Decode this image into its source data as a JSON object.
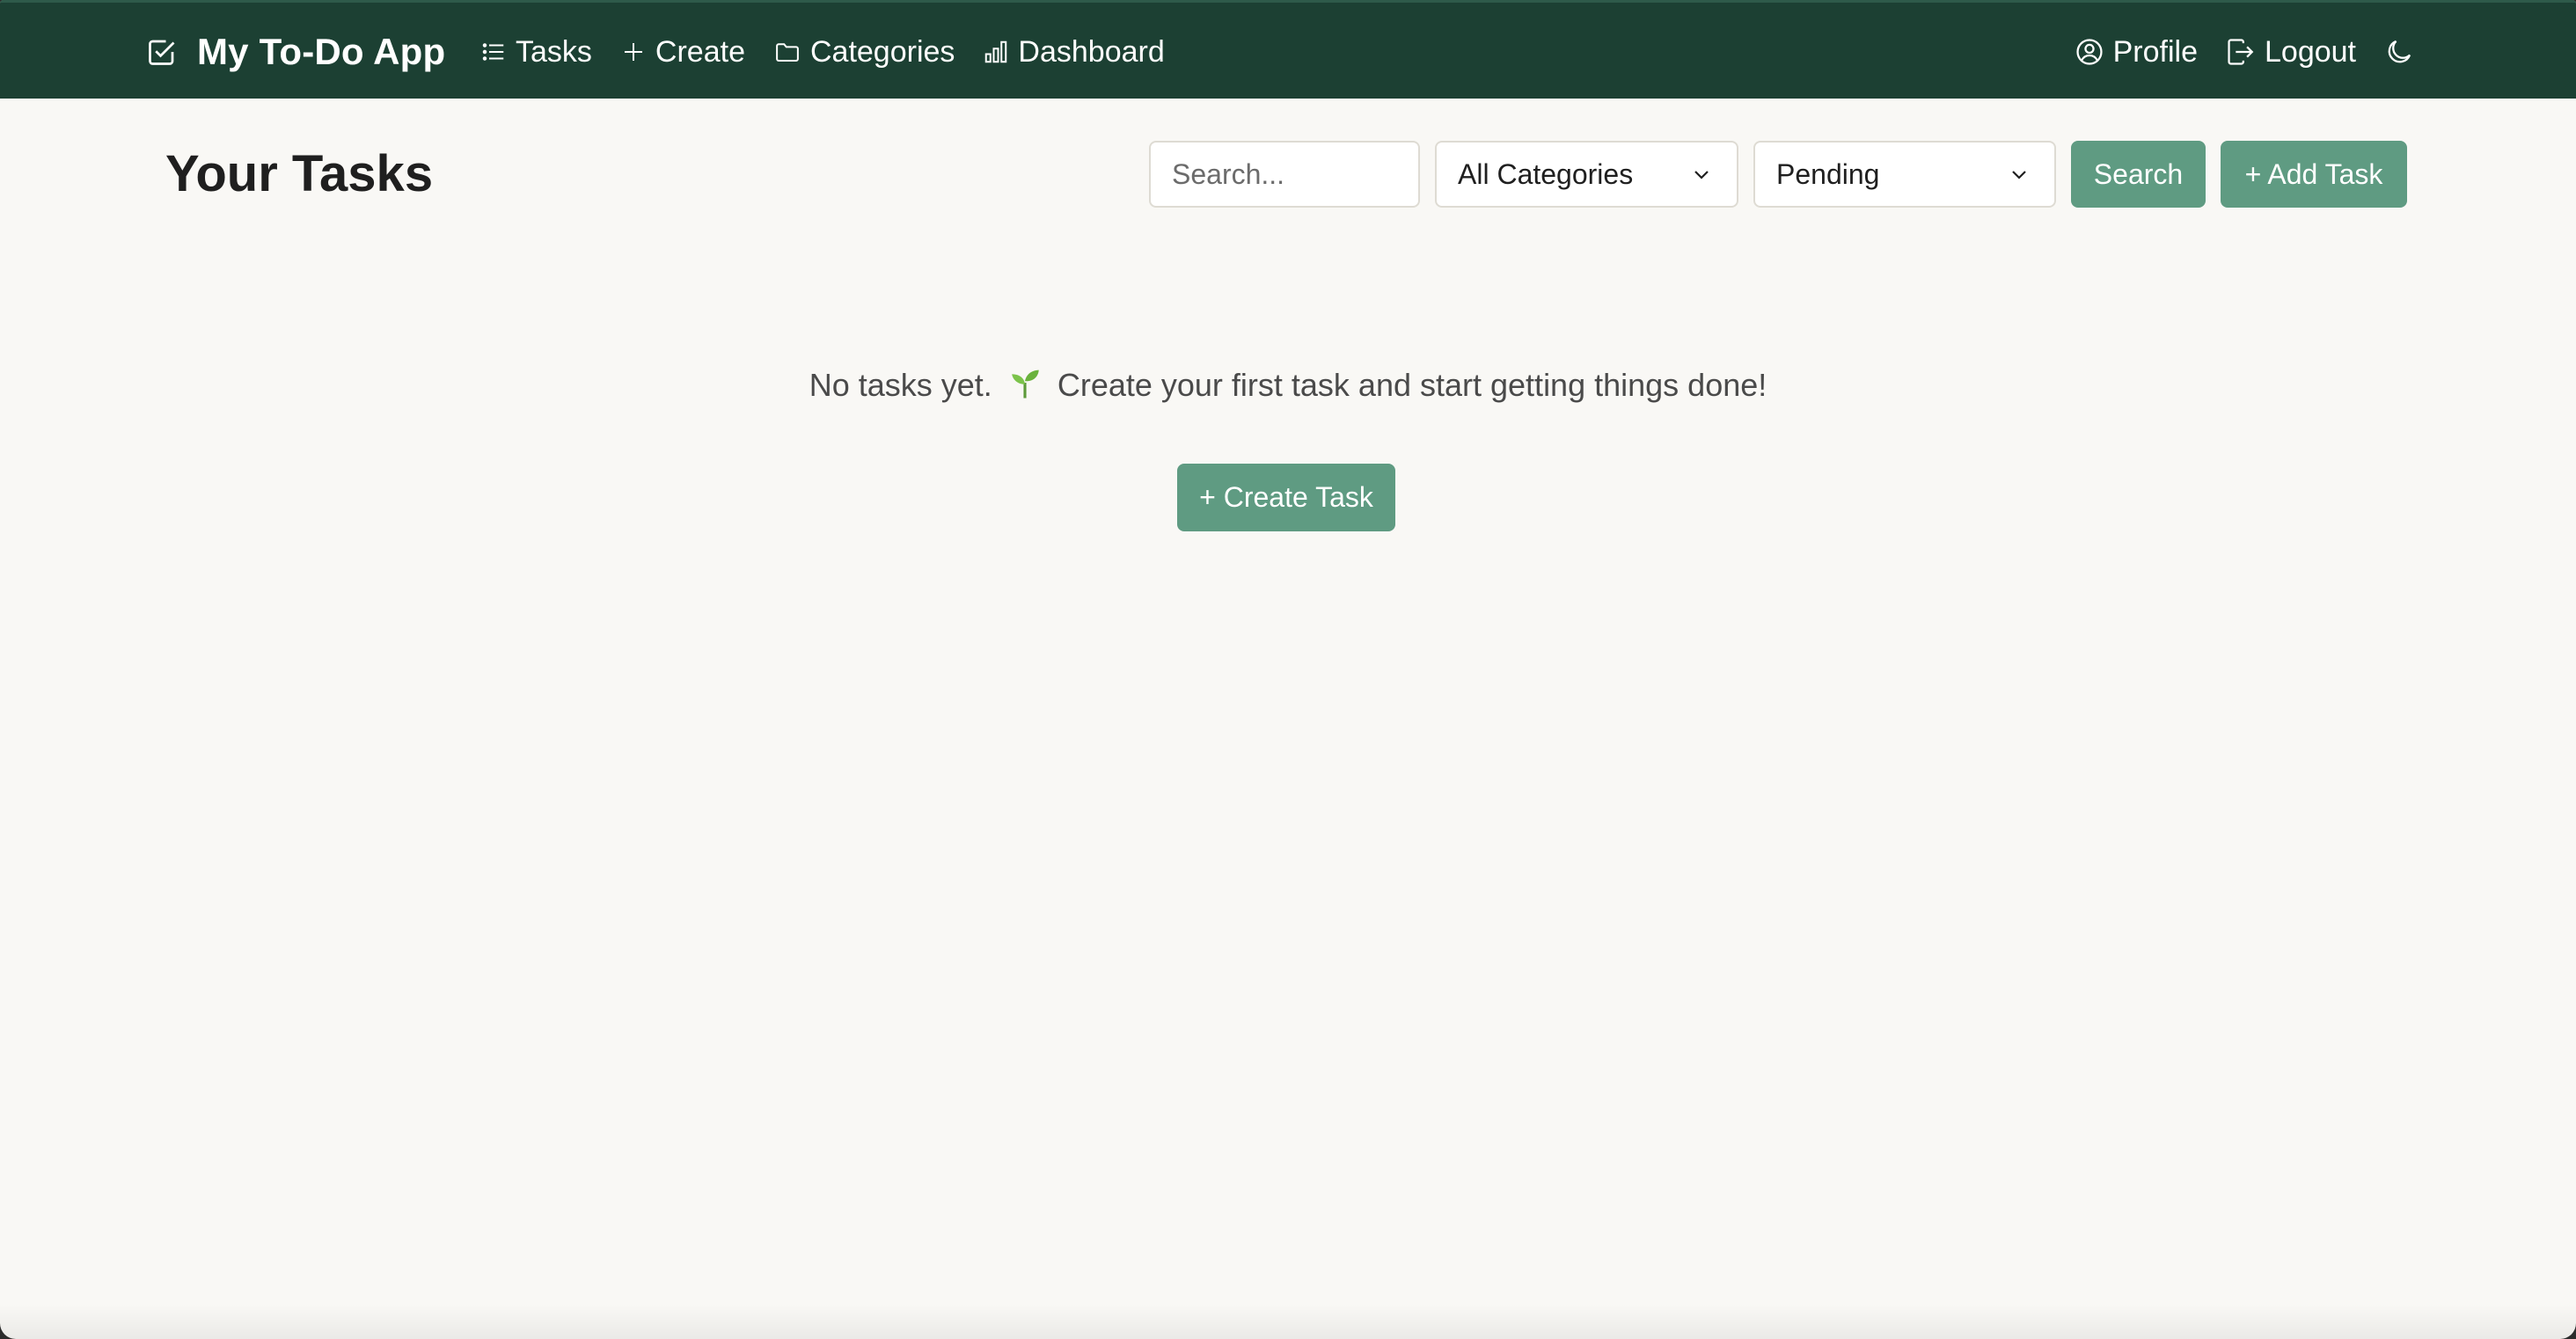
{
  "navbar": {
    "brand": "My To-Do App",
    "brand_icon": "check-square-icon",
    "links": [
      {
        "label": "Tasks",
        "icon": "list-icon"
      },
      {
        "label": "Create",
        "icon": "plus-icon"
      },
      {
        "label": "Categories",
        "icon": "folder-icon"
      },
      {
        "label": "Dashboard",
        "icon": "bar-chart-icon"
      }
    ],
    "right": [
      {
        "label": "Profile",
        "icon": "user-circle-icon"
      },
      {
        "label": "Logout",
        "icon": "logout-icon"
      }
    ],
    "theme_toggle_icon": "moon-icon"
  },
  "header": {
    "title": "Your Tasks"
  },
  "toolbar": {
    "search_placeholder": "Search...",
    "category_selected": "All Categories",
    "status_selected": "Pending",
    "search_label": "Search",
    "add_label": "+ Add Task"
  },
  "empty_state": {
    "message_before": "No tasks yet.",
    "message_after": "Create your first task and start getting things done!",
    "button_label": "+ Create Task"
  },
  "colors": {
    "navbar_bg": "#1c4033",
    "accent": "#5f9b82",
    "page_bg": "#f9f8f5"
  }
}
